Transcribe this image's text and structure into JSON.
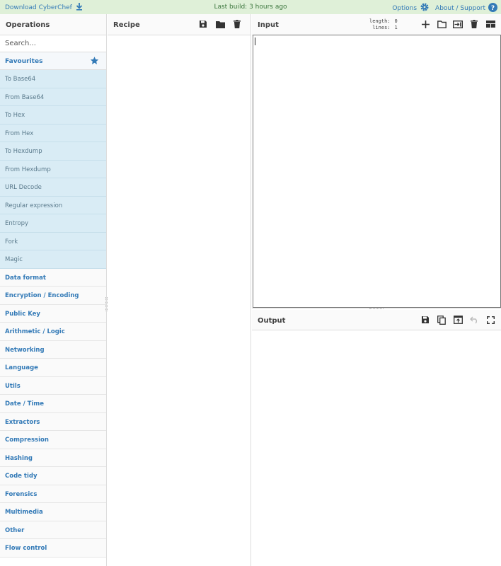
{
  "topbar": {
    "download_label": "Download CyberChef",
    "build_text": "Last build: 3 hours ago",
    "options_label": "Options",
    "about_label": "About / Support"
  },
  "operations": {
    "title": "Operations",
    "search_placeholder": "Search...",
    "favourites_label": "Favourites",
    "favourites": [
      "To Base64",
      "From Base64",
      "To Hex",
      "From Hex",
      "To Hexdump",
      "From Hexdump",
      "URL Decode",
      "Regular expression",
      "Entropy",
      "Fork",
      "Magic"
    ],
    "categories": [
      "Data format",
      "Encryption / Encoding",
      "Public Key",
      "Arithmetic / Logic",
      "Networking",
      "Language",
      "Utils",
      "Date / Time",
      "Extractors",
      "Compression",
      "Hashing",
      "Code tidy",
      "Forensics",
      "Multimedia",
      "Other",
      "Flow control"
    ]
  },
  "recipe": {
    "title": "Recipe"
  },
  "input": {
    "title": "Input",
    "length_label": "length:",
    "length_value": "0",
    "lines_label": "lines:",
    "lines_value": "1"
  },
  "output": {
    "title": "Output"
  },
  "colors": {
    "accent": "#337ab7",
    "topbar_bg": "#dff0d8",
    "favourite_bg": "#d9ecf5"
  }
}
